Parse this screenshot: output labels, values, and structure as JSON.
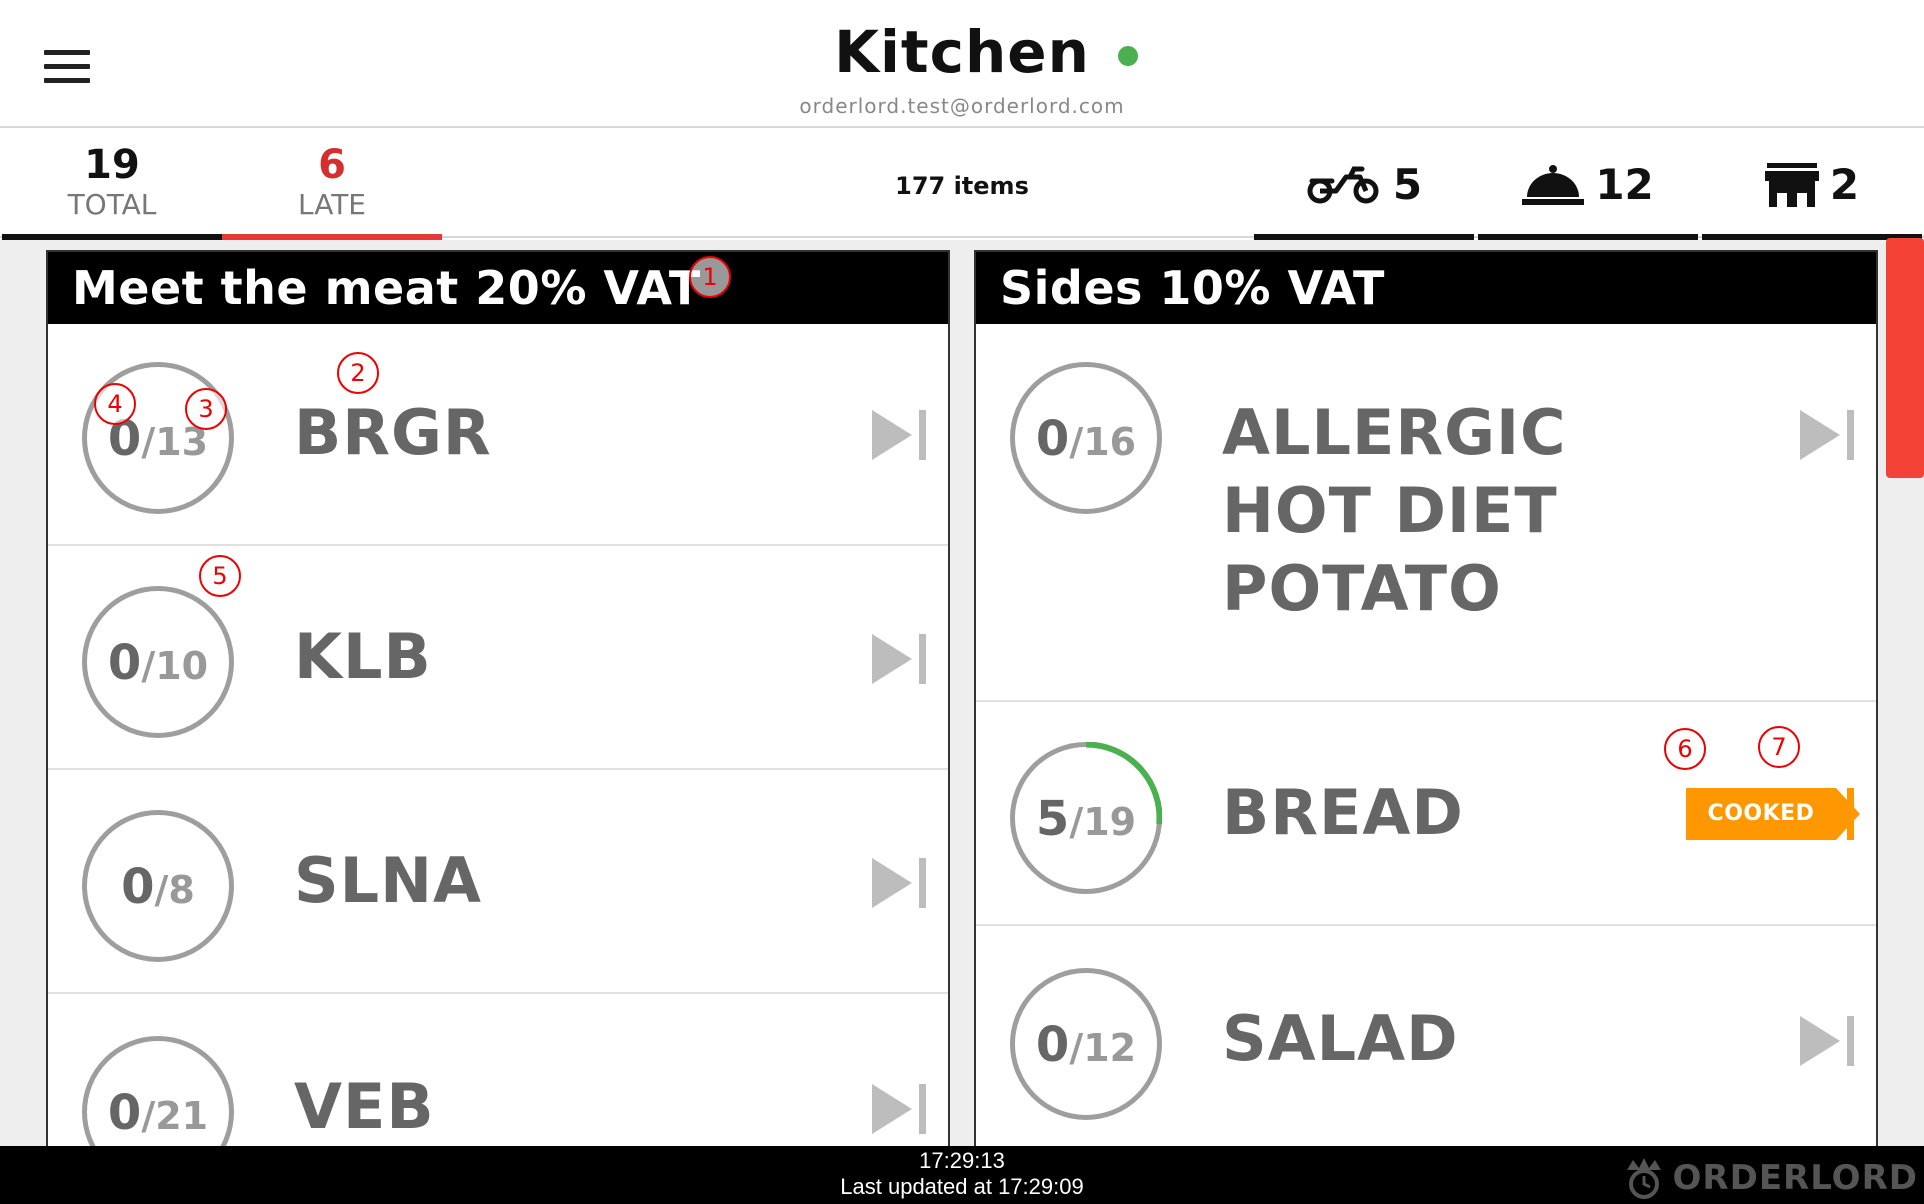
{
  "header": {
    "title": "Kitchen",
    "email": "orderlord.test@orderlord.com",
    "status_color": "#4caf50"
  },
  "stats": {
    "total": {
      "value": "19",
      "label": "TOTAL"
    },
    "late": {
      "value": "6",
      "label": "LATE"
    },
    "items": "177 items",
    "delivery_count": "5",
    "dinein_count": "12",
    "takeaway_count": "2"
  },
  "sections": [
    {
      "title": "Meet the meat 20% VAT",
      "items": [
        {
          "name": "BRGR",
          "done": "0",
          "total": "/13"
        },
        {
          "name": "KLB",
          "done": "0",
          "total": "/10"
        },
        {
          "name": "SLNA",
          "done": "0",
          "total": "/8"
        },
        {
          "name": "VEB",
          "done": "0",
          "total": "/21"
        }
      ]
    },
    {
      "title": "Sides 10% VAT",
      "items": [
        {
          "name_lines": [
            "ALLERGIC",
            "HOT DIET",
            "POTATO"
          ],
          "done": "0",
          "total": "/16"
        },
        {
          "name": "BREAD",
          "done": "5",
          "total": "/19",
          "progress": 0.263,
          "action": "COOKED"
        },
        {
          "name": "SALAD",
          "done": "0",
          "total": "/12"
        }
      ]
    }
  ],
  "footer": {
    "time": "17:29:13",
    "updated": "Last updated at 17:29:09",
    "logo": "ORDERLORD"
  },
  "markers": [
    "1",
    "2",
    "3",
    "4",
    "5",
    "6",
    "7"
  ],
  "icons": {
    "menu": "hamburger-menu-icon",
    "delivery": "scooter-icon",
    "dinein": "cloche-icon",
    "takeaway": "store-icon",
    "skip": "skip-next-icon"
  },
  "colors": {
    "late": "#e53935",
    "cooked": "#ff9800",
    "progress": "#4caf50",
    "scrollbar": "#f44336"
  }
}
